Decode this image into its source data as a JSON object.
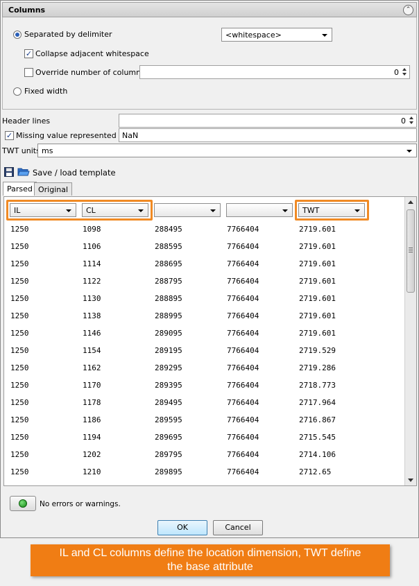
{
  "columns_section": {
    "title": "Columns",
    "separated_label": "Separated by delimiter",
    "delimiter_value": "<whitespace>",
    "collapse_label": "Collapse adjacent whitespace",
    "override_label": "Override number of columns",
    "override_value": "0",
    "fixed_width_label": "Fixed width",
    "separated_checked": true,
    "collapse_checked": true,
    "override_checked": false,
    "fixed_checked": false
  },
  "header_lines": {
    "label": "Header lines",
    "value": "0"
  },
  "missing_value": {
    "label": "Missing value represented by",
    "value": "NaN",
    "checked": true
  },
  "twt_units": {
    "label": "TWT units",
    "value": "ms"
  },
  "template": {
    "label": "Save / load template",
    "save_icon": "floppy-disk-icon",
    "open_icon": "folder-open-icon"
  },
  "tabs": [
    {
      "label": "Parsed",
      "active": true
    },
    {
      "label": "Original",
      "active": false
    }
  ],
  "column_selectors": [
    "IL",
    "CL",
    "",
    "",
    "TWT"
  ],
  "rows": [
    [
      "1250",
      "1098",
      "288495",
      "7766404",
      "2719.601"
    ],
    [
      "1250",
      "1106",
      "288595",
      "7766404",
      "2719.601"
    ],
    [
      "1250",
      "1114",
      "288695",
      "7766404",
      "2719.601"
    ],
    [
      "1250",
      "1122",
      "288795",
      "7766404",
      "2719.601"
    ],
    [
      "1250",
      "1130",
      "288895",
      "7766404",
      "2719.601"
    ],
    [
      "1250",
      "1138",
      "288995",
      "7766404",
      "2719.601"
    ],
    [
      "1250",
      "1146",
      "289095",
      "7766404",
      "2719.601"
    ],
    [
      "1250",
      "1154",
      "289195",
      "7766404",
      "2719.529"
    ],
    [
      "1250",
      "1162",
      "289295",
      "7766404",
      "2719.286"
    ],
    [
      "1250",
      "1170",
      "289395",
      "7766404",
      "2718.773"
    ],
    [
      "1250",
      "1178",
      "289495",
      "7766404",
      "2717.964"
    ],
    [
      "1250",
      "1186",
      "289595",
      "7766404",
      "2716.867"
    ],
    [
      "1250",
      "1194",
      "289695",
      "7766404",
      "2715.545"
    ],
    [
      "1250",
      "1202",
      "289795",
      "7766404",
      "2714.106"
    ],
    [
      "1250",
      "1210",
      "289895",
      "7766404",
      "2712.65"
    ]
  ],
  "status": {
    "text": "No errors or warnings.",
    "color": "#1f9a1f"
  },
  "buttons": {
    "ok": "OK",
    "cancel": "Cancel"
  },
  "callout": {
    "line1": "IL and CL columns define the location dimension, TWT define",
    "line2": "the base attribute",
    "color": "#f07d14"
  },
  "highlight_color": "#f08a24"
}
